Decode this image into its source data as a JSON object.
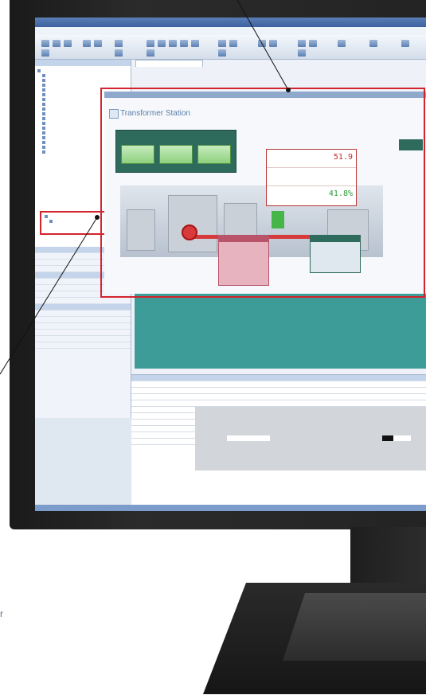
{
  "caption": {
    "tail_char": "r"
  },
  "app": {
    "title": "",
    "menu": [
      "",
      "",
      "",
      "",
      "",
      "",
      "",
      ""
    ]
  },
  "project_tree": {
    "header": "",
    "items": [
      "",
      "",
      "",
      "",
      "",
      "",
      "",
      "",
      "",
      "",
      "",
      "",
      "",
      "",
      "",
      "",
      "",
      "",
      "",
      ""
    ]
  },
  "hmi": {
    "screen_title": "Transformer Station",
    "buttons": [
      "",
      "",
      ""
    ],
    "readouts": [
      {
        "label": "",
        "value": "51.9"
      },
      {
        "label": "",
        "value": ""
      },
      {
        "label": "",
        "value": "41.8%"
      }
    ]
  },
  "colors": {
    "callout_red": "#d3232c",
    "teal_canvas": "#3e9c98",
    "panel_green": "#2f6b5c"
  }
}
